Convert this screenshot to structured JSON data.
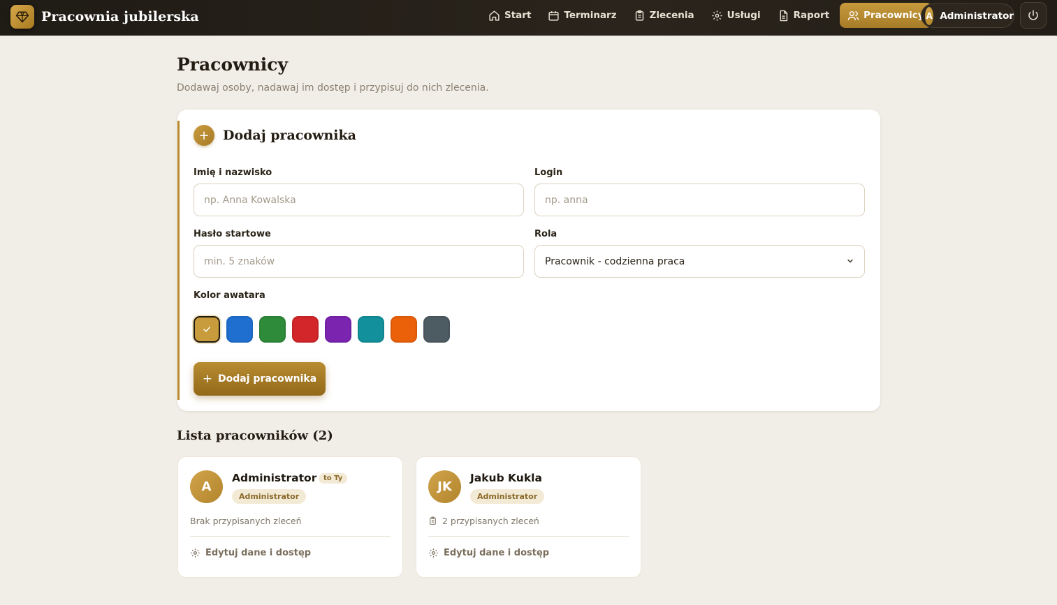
{
  "app": {
    "title": "Pracownia jubilerska"
  },
  "nav": {
    "items": [
      {
        "label": "Start",
        "icon": "home-icon"
      },
      {
        "label": "Terminarz",
        "icon": "calendar-icon"
      },
      {
        "label": "Zlecenia",
        "icon": "clipboard-icon"
      },
      {
        "label": "Usługi",
        "icon": "gear-icon"
      },
      {
        "label": "Raport",
        "icon": "document-icon"
      },
      {
        "label": "Pracownicy",
        "icon": "users-icon",
        "active": true
      }
    ]
  },
  "user": {
    "initial": "A",
    "name": "Administrator"
  },
  "page": {
    "title": "Pracownicy",
    "subtitle": "Dodawaj osoby, nadawaj im dostęp i przypisuj do nich zlecenia."
  },
  "form": {
    "title": "Dodaj pracownika",
    "name_label": "Imię i nazwisko",
    "name_placeholder": "np. Anna Kowalska",
    "login_label": "Login",
    "login_placeholder": "np. anna",
    "password_label": "Hasło startowe",
    "password_placeholder": "min. 5 znaków",
    "role_label": "Rola",
    "role_value": "Pracownik - codzienna praca",
    "color_label": "Kolor awatara",
    "colors": [
      "#c89b3c",
      "#1f6fd0",
      "#2e8b3a",
      "#d2262a",
      "#7a24b0",
      "#12909b",
      "#ea6109",
      "#4d5b63"
    ],
    "selected_color_index": 0,
    "submit_label": "Dodaj pracownika"
  },
  "list": {
    "title": "Lista pracowników (2)",
    "employees": [
      {
        "initials": "A",
        "name": "Administrator",
        "you_badge": "to Ty",
        "role": "Administrator",
        "assignments": "Brak przypisanych zleceń",
        "edit_label": "Edytuj dane i dostęp"
      },
      {
        "initials": "JK",
        "name": "Jakub Kukla",
        "role": "Administrator",
        "assignments": "2 przypisanych zleceń",
        "edit_label": "Edytuj dane i dostęp"
      }
    ]
  }
}
